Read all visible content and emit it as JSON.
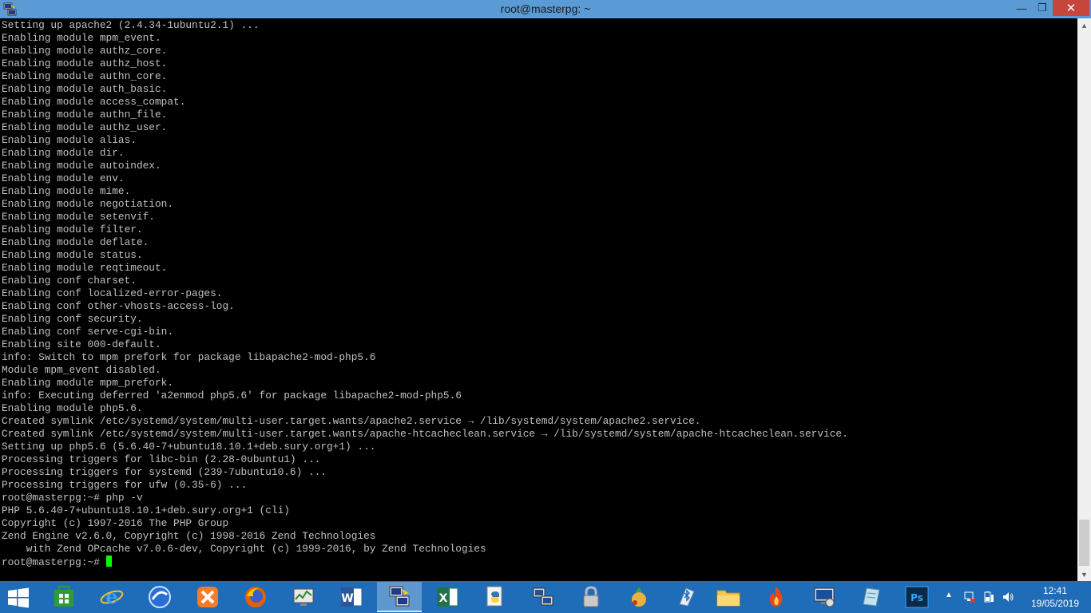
{
  "window": {
    "title": "root@masterpg: ~",
    "minimize_glyph": "—",
    "maximize_glyph": "❐",
    "close_glyph": "✕"
  },
  "terminal": {
    "lines": [
      "Setting up apache2 (2.4.34-1ubuntu2.1) ...",
      "Enabling module mpm_event.",
      "Enabling module authz_core.",
      "Enabling module authz_host.",
      "Enabling module authn_core.",
      "Enabling module auth_basic.",
      "Enabling module access_compat.",
      "Enabling module authn_file.",
      "Enabling module authz_user.",
      "Enabling module alias.",
      "Enabling module dir.",
      "Enabling module autoindex.",
      "Enabling module env.",
      "Enabling module mime.",
      "Enabling module negotiation.",
      "Enabling module setenvif.",
      "Enabling module filter.",
      "Enabling module deflate.",
      "Enabling module status.",
      "Enabling module reqtimeout.",
      "Enabling conf charset.",
      "Enabling conf localized-error-pages.",
      "Enabling conf other-vhosts-access-log.",
      "Enabling conf security.",
      "Enabling conf serve-cgi-bin.",
      "Enabling site 000-default.",
      "info: Switch to mpm prefork for package libapache2-mod-php5.6",
      "Module mpm_event disabled.",
      "Enabling module mpm_prefork.",
      "info: Executing deferred 'a2enmod php5.6' for package libapache2-mod-php5.6",
      "Enabling module php5.6.",
      "Created symlink /etc/systemd/system/multi-user.target.wants/apache2.service → /lib/systemd/system/apache2.service.",
      "Created symlink /etc/systemd/system/multi-user.target.wants/apache-htcacheclean.service → /lib/systemd/system/apache-htcacheclean.service.",
      "Setting up php5.6 (5.6.40-7+ubuntu18.10.1+deb.sury.org+1) ...",
      "Processing triggers for libc-bin (2.28-0ubuntu1) ...",
      "Processing triggers for systemd (239-7ubuntu10.6) ...",
      "Processing triggers for ufw (0.35-6) ...",
      "root@masterpg:~# php -v",
      "PHP 5.6.40-7+ubuntu18.10.1+deb.sury.org+1 (cli)",
      "Copyright (c) 1997-2016 The PHP Group",
      "Zend Engine v2.6.0, Copyright (c) 1998-2016 Zend Technologies",
      "    with Zend OPcache v7.0.6-dev, Copyright (c) 1999-2016, by Zend Technologies"
    ],
    "prompt": "root@masterpg:~# ",
    "cursor_color": "#00ff00"
  },
  "scrollbar": {
    "up_glyph": "▲",
    "down_glyph": "▼"
  },
  "taskbar": {
    "apps": [
      {
        "name": "start-menu-tiles",
        "icon": "store-icon"
      },
      {
        "name": "internet-explorer",
        "icon": "ie-icon"
      },
      {
        "name": "browser-globe",
        "icon": "globe-icon"
      },
      {
        "name": "xampp",
        "icon": "xampp-icon"
      },
      {
        "name": "firefox",
        "icon": "firefox-icon"
      },
      {
        "name": "resource-monitor",
        "icon": "monitor-icon"
      },
      {
        "name": "word",
        "icon": "word-icon"
      },
      {
        "name": "putty",
        "icon": "putty-icon",
        "active": true
      },
      {
        "name": "excel",
        "icon": "excel-icon"
      },
      {
        "name": "python",
        "icon": "python-icon"
      },
      {
        "name": "network-tool",
        "icon": "network-icon"
      },
      {
        "name": "lock-app",
        "icon": "lock-icon"
      },
      {
        "name": "game-app",
        "icon": "game-icon"
      },
      {
        "name": "bluetooth-file-transfer",
        "icon": "bluetooth-icon"
      },
      {
        "name": "file-explorer",
        "icon": "folder-icon"
      },
      {
        "name": "fire-app",
        "icon": "fire-icon"
      },
      {
        "name": "remote-desktop",
        "icon": "remote-icon"
      },
      {
        "name": "notepad",
        "icon": "notepad-icon"
      },
      {
        "name": "photoshop",
        "icon": "photoshop-icon"
      }
    ],
    "photoshop_label": "Ps",
    "word_label": "W",
    "excel_label": "X",
    "tray_arrow": "▲",
    "clock_time": "12:41",
    "clock_date": "19/05/2019"
  }
}
